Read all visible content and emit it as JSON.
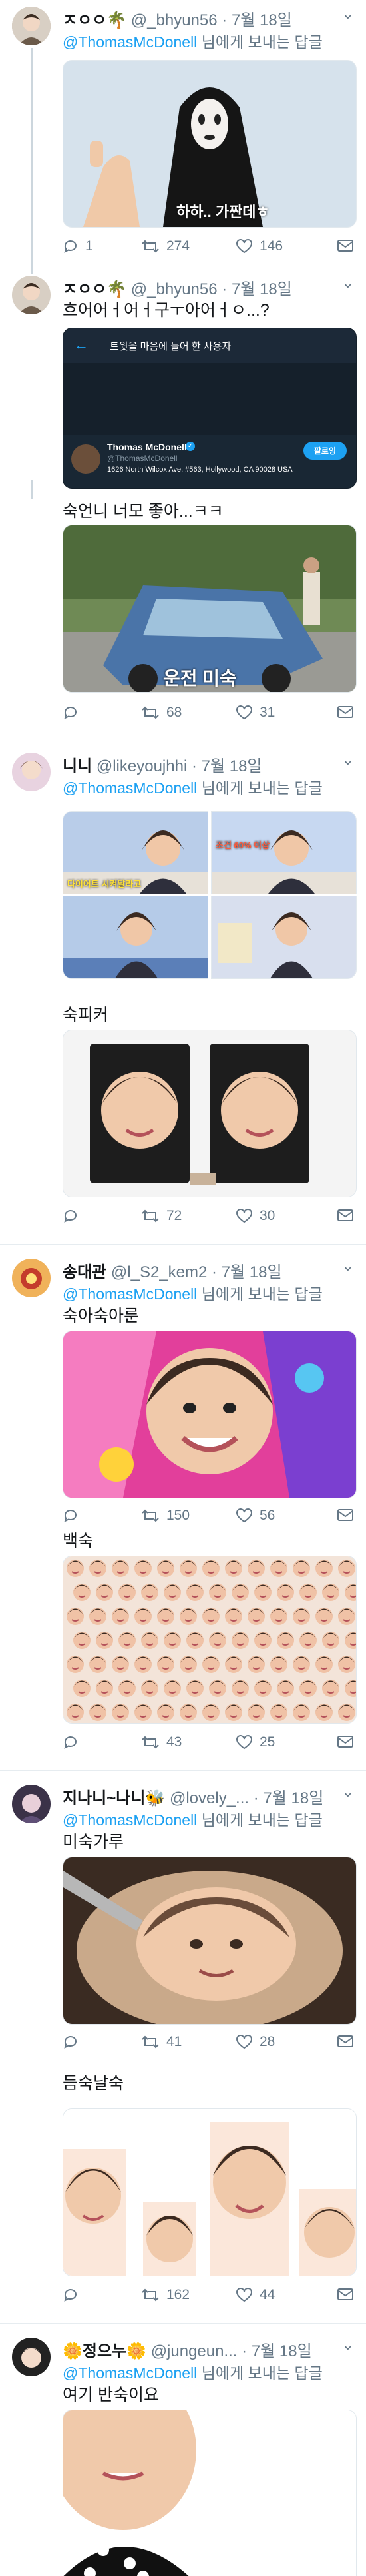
{
  "tweets": [
    {
      "name": "ㅈㅇㅇ🌴",
      "handle": "@_bhyun56",
      "date": "7월 18일",
      "reply_to": "@ThomasMcDonell",
      "reply_suffix": "님에게 보내는 답글",
      "caption": "하하.. 가짠데ㅎ",
      "replies": "1",
      "retweets": "274",
      "likes": "146"
    },
    {
      "name": "ㅈㅇㅇ🌴",
      "handle": "@_bhyun56",
      "date": "7월 18일",
      "text": "흐어어ㅓ어ㅓ구ㅜ아어ㅓㅇ...?",
      "card_title": "트윗을 마음에 들어 한 사용자",
      "card_user": "Thomas McDonell",
      "card_handle": "@ThomasMcDonell",
      "card_address": "1626 North Wilcox Ave, #563, Hollywood, CA 90028 USA",
      "card_follow": "팔로잉"
    },
    {
      "text": "숙언니 너모 좋아...ㅋㅋ",
      "caption": "운전 미숙",
      "replies": "",
      "retweets": "68",
      "likes": "31"
    },
    {
      "name": "니니",
      "handle": "@likeyoujhhi",
      "date": "7월 18일",
      "reply_to": "@ThomasMcDonell",
      "reply_suffix": "님에게 보내는 답글",
      "tile_caps": [
        "다이어트 시켜달라고",
        "조건 60% 이상",
        "",
        ""
      ]
    },
    {
      "text": "숙피커",
      "replies": "",
      "retweets": "72",
      "likes": "30"
    },
    {
      "name": "송대관",
      "handle": "@l_S2_kem2",
      "date": "7월 18일",
      "reply_to": "@ThomasMcDonell",
      "reply_suffix": "님에게 보내는 답글",
      "text": "숙아숙아룬",
      "retweets": "150",
      "likes": "56"
    },
    {
      "text": "백숙",
      "replies": "",
      "retweets": "43",
      "likes": "25"
    },
    {
      "name": "지나니~나니🐝",
      "handle": "@lovely_...",
      "date": "7월 18일",
      "reply_to": "@ThomasMcDonell",
      "reply_suffix": "님에게 보내는 답글",
      "text": "미숙가루",
      "replies": "",
      "retweets": "41",
      "likes": "28"
    },
    {
      "text": "듬숙날숙",
      "replies": "",
      "retweets": "162",
      "likes": "44"
    },
    {
      "name": "🌼정으누🌼",
      "handle": "@jungeun...",
      "date": "7월 18일",
      "reply_to": "@ThomasMcDonell",
      "reply_suffix": "님에게 보내는 답글",
      "text": "여기 반숙이요"
    }
  ],
  "colors": {
    "link": "#1da1f2",
    "muted": "#657786",
    "divider": "#e6ecf0"
  }
}
